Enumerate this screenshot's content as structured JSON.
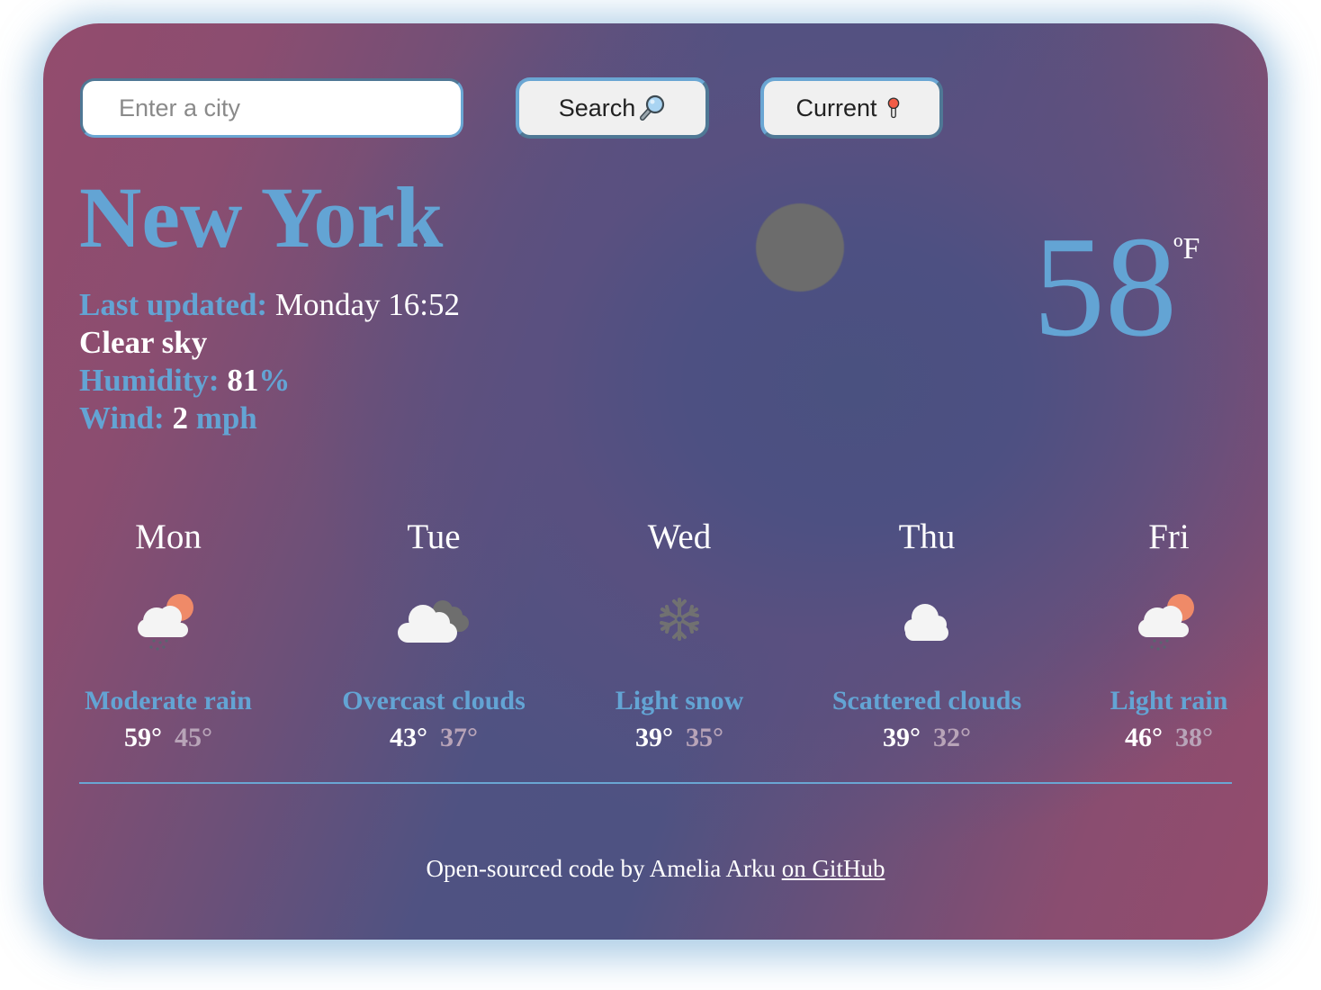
{
  "search": {
    "placeholder": "Enter a city",
    "value": "",
    "search_label": "Search",
    "search_icon": "magnifying-glass-icon",
    "current_label": "Current",
    "current_icon": "round-pushpin-icon"
  },
  "current": {
    "city": "New York",
    "last_updated_label": "Last updated:",
    "last_updated_value": "Monday 16:52",
    "description": "Clear sky",
    "humidity_label": "Humidity:",
    "humidity_value": "81",
    "humidity_unit": "%",
    "wind_label": "Wind:",
    "wind_value": "2",
    "wind_unit": "mph",
    "icon": "clear-sky-icon",
    "temperature": "58",
    "unit": "ºF"
  },
  "forecast": [
    {
      "day": "Mon",
      "icon": "rain-sun-cloud-icon",
      "description": "Moderate rain",
      "max": "59°",
      "min": "45°"
    },
    {
      "day": "Tue",
      "icon": "overcast-clouds-icon",
      "description": "Overcast clouds",
      "max": "43°",
      "min": "37°"
    },
    {
      "day": "Wed",
      "icon": "snowflake-icon",
      "description": "Light snow",
      "max": "39°",
      "min": "35°"
    },
    {
      "day": "Thu",
      "icon": "cloud-icon",
      "description": "Scattered clouds",
      "max": "39°",
      "min": "32°"
    },
    {
      "day": "Fri",
      "icon": "rain-sun-cloud-icon",
      "description": "Light rain",
      "max": "46°",
      "min": "38°"
    }
  ],
  "footer": {
    "text": "Open-sourced code by Amelia Arku ",
    "link_label": "on GitHub"
  },
  "colors": {
    "accent": "#63a4d4",
    "gradient_edge": "#934c6d",
    "gradient_center": "#4a5180",
    "min_temp": "#b8a4b8",
    "glow": "#6ea5d2"
  }
}
